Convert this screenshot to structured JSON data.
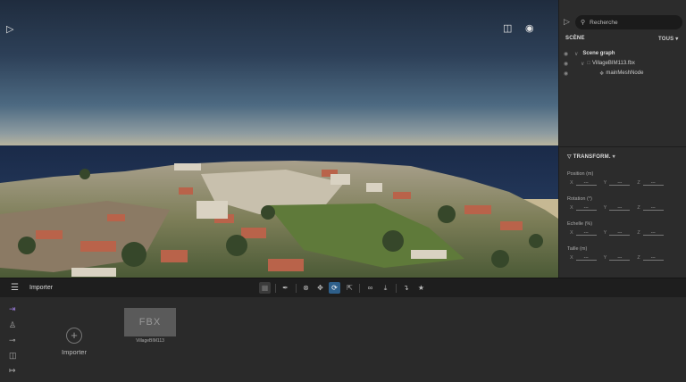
{
  "viewport": {
    "play_icon": "play-icon",
    "panel_toggle_icon": "panel-icon",
    "visibility_icon": "eye-icon"
  },
  "panel": {
    "search": {
      "placeholder": "Recherche"
    },
    "scene_header": "SCÈNE",
    "filter_label": "TOUS",
    "tree": [
      {
        "label": "Scene graph",
        "bold": true
      },
      {
        "label": "VillageBIM113.fbx"
      },
      {
        "label": "mainMeshNode"
      }
    ],
    "transform": {
      "header": "TRANSFORM.",
      "fields": [
        {
          "label": "Position (m)"
        },
        {
          "label": "Rotation (°)"
        },
        {
          "label": "Echelle (%)"
        },
        {
          "label": "Taille (m)"
        }
      ],
      "axes": [
        "X",
        "Y",
        "Z"
      ],
      "placeholder_value": "---"
    }
  },
  "toolbar": {
    "title": "Importer",
    "menu_icon": "hamburger-icon"
  },
  "bottom": {
    "importer_label": "Importer",
    "assets": [
      {
        "thumb_label": "FBX",
        "name": "VillageBIM113"
      }
    ]
  },
  "colors": {
    "accent": "#2e5f8a",
    "side_active": "#9a7bd8",
    "panel_bg": "#2c2c2c",
    "toolbar_bg": "#1e1e1e"
  }
}
